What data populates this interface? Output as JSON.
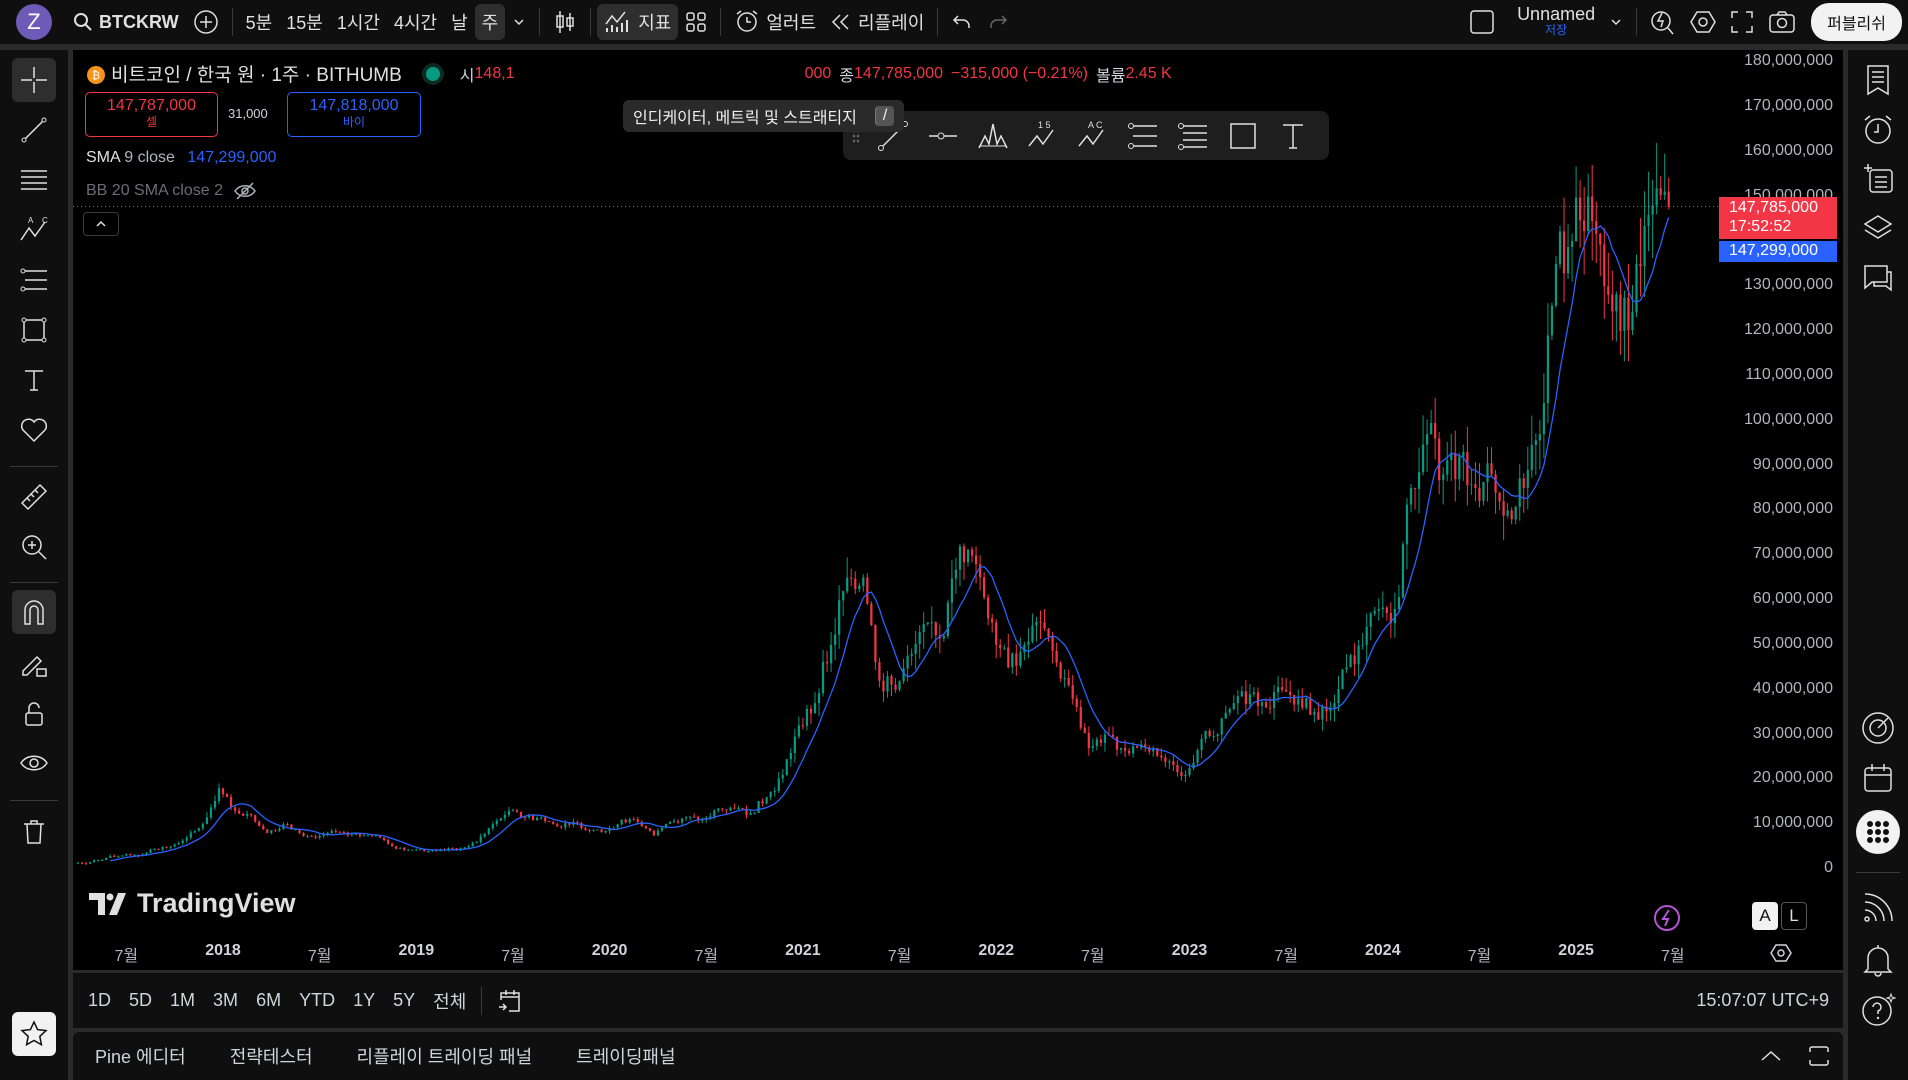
{
  "topbar": {
    "avatar": "Z",
    "symbol": "BTCKRW",
    "intervals": [
      "5분",
      "15분",
      "1시간",
      "4시간",
      "날",
      "주"
    ],
    "active_interval": "주",
    "indicators": "지표",
    "alert": "얼러트",
    "replay": "리플레이",
    "layout_name": "Unnamed",
    "layout_save": "저장",
    "publish": "퍼블리쉬"
  },
  "tooltip": {
    "text": "인디케이터, 메트릭 및 스트래티지",
    "key": "/"
  },
  "legend": {
    "title": "비트코인 / 한국 원 · 1주 · BITHUMB",
    "open_label": "시",
    "open_value": "148,1",
    "tail": "000",
    "close_label": "종",
    "close_value": "147,785,000",
    "change": "−315,000 (−0.21%)",
    "volume_label": "볼륨",
    "volume_value": "2.45 K"
  },
  "trade": {
    "sell_price": "147,787,000",
    "sell_label": "셀",
    "spread": "31,000",
    "buy_price": "147,818,000",
    "buy_label": "바이"
  },
  "indicators": [
    {
      "name": "SMA",
      "params": "9 close",
      "value": "147,299,000"
    },
    {
      "name": "BB",
      "params": "20 SMA close 2"
    }
  ],
  "price_labels": {
    "last": "147,785,000",
    "countdown": "17:52:52",
    "sma": "147,299,000"
  },
  "watermark": "TradingView",
  "scale_buttons": [
    "A",
    "L"
  ],
  "range_buttons": [
    "1D",
    "5D",
    "1M",
    "3M",
    "6M",
    "YTD",
    "1Y",
    "5Y",
    "전체"
  ],
  "clock": "15:07:07 UTC+9",
  "bottom_tabs": [
    "Pine 에디터",
    "전략테스터",
    "리플레이 트레이딩 패널",
    "트레이딩패널"
  ],
  "colors": {
    "up": "#089981",
    "down": "#f23645",
    "sma": "#2962ff",
    "background": "#000000"
  },
  "chart_data": {
    "type": "candlestick",
    "title": "BTCKRW 1W BITHUMB",
    "ylim": [
      0,
      180000000
    ],
    "y_ticks": [
      {
        "v": 180000000,
        "t": "180,000,000"
      },
      {
        "v": 170000000,
        "t": "170,000,000"
      },
      {
        "v": 160000000,
        "t": "160,000,000"
      },
      {
        "v": 150000000,
        "t": "150,000,000"
      },
      {
        "v": 130000000,
        "t": "130,000,000"
      },
      {
        "v": 120000000,
        "t": "120,000,000"
      },
      {
        "v": 110000000,
        "t": "110,000,000"
      },
      {
        "v": 100000000,
        "t": "100,000,000"
      },
      {
        "v": 90000000,
        "t": "90,000,000"
      },
      {
        "v": 80000000,
        "t": "80,000,000"
      },
      {
        "v": 70000000,
        "t": "70,000,000"
      },
      {
        "v": 60000000,
        "t": "60,000,000"
      },
      {
        "v": 50000000,
        "t": "50,000,000"
      },
      {
        "v": 40000000,
        "t": "40,000,000"
      },
      {
        "v": 30000000,
        "t": "30,000,000"
      },
      {
        "v": 20000000,
        "t": "20,000,000"
      },
      {
        "v": 10000000,
        "t": "10,000,000"
      },
      {
        "v": 0,
        "t": "0"
      }
    ],
    "x_ticks": [
      {
        "v": 2017.5,
        "t": "7월"
      },
      {
        "v": 2018,
        "t": "2018"
      },
      {
        "v": 2018.5,
        "t": "7월"
      },
      {
        "v": 2019,
        "t": "2019"
      },
      {
        "v": 2019.5,
        "t": "7월"
      },
      {
        "v": 2020,
        "t": "2020"
      },
      {
        "v": 2020.5,
        "t": "7월"
      },
      {
        "v": 2021,
        "t": "2021"
      },
      {
        "v": 2021.5,
        "t": "7월"
      },
      {
        "v": 2022,
        "t": "2022"
      },
      {
        "v": 2022.5,
        "t": "7월"
      },
      {
        "v": 2023,
        "t": "2023"
      },
      {
        "v": 2023.5,
        "t": "7월"
      },
      {
        "v": 2024,
        "t": "2024"
      },
      {
        "v": 2024.5,
        "t": "7월"
      },
      {
        "v": 2025,
        "t": "2025"
      },
      {
        "v": 2025.5,
        "t": "7월"
      }
    ],
    "start": 2017.25,
    "monthly_close_millions": [
      1.5,
      2.5,
      3,
      3,
      4.5,
      5,
      7,
      10,
      18,
      13,
      12,
      8,
      10,
      8,
      7,
      8.5,
      7.5,
      7.5,
      7,
      4.5,
      4.3,
      4,
      4.3,
      4.6,
      6,
      10,
      13,
      11.5,
      11.5,
      9.5,
      10.5,
      8.7,
      8.5,
      11,
      10.5,
      7.5,
      10.5,
      11.5,
      11,
      13.5,
      13.5,
      12.5,
      16,
      21,
      32,
      37,
      50,
      65,
      65,
      42,
      40,
      48,
      55,
      52,
      72,
      68,
      55,
      45,
      50,
      55,
      46,
      38,
      27,
      30,
      27,
      27,
      27,
      24,
      21,
      29,
      30,
      37,
      39,
      36,
      40,
      38,
      35,
      36,
      45,
      50,
      58,
      58,
      85,
      97,
      88,
      92,
      85,
      88,
      80,
      85,
      97,
      135,
      140,
      150,
      130,
      120,
      135,
      148,
      147.8
    ],
    "sma_period": 9,
    "last_price": 147785000
  }
}
